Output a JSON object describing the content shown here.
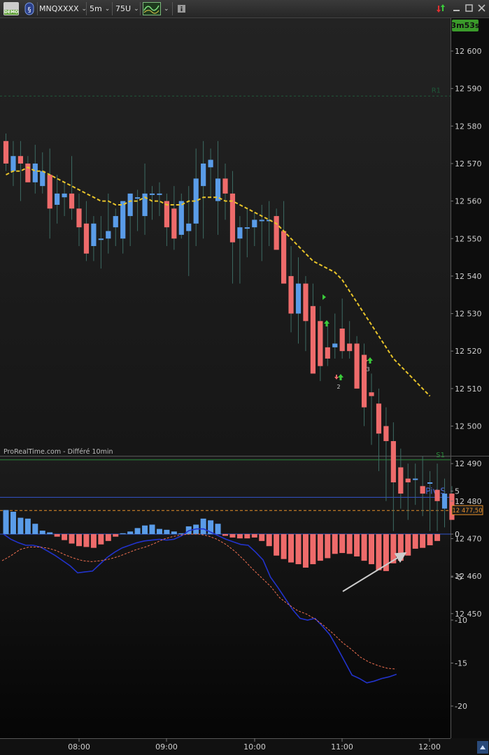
{
  "toolbar": {
    "demo_label": "DEMO",
    "symbol": "MNQXXXX",
    "timeframe": "5m",
    "units": "75U",
    "indicator_icon": "indicator-chart-icon",
    "info_icon": "info-icon"
  },
  "price_panel": {
    "timer": "3m53s",
    "watermark": "ProRealTime.com - Différé 10min",
    "y_ticks": [
      "12 600",
      "12 590",
      "12 580",
      "12 570",
      "12 560",
      "12 550",
      "12 540",
      "12 530",
      "12 520",
      "12 510",
      "12 500",
      "12 490",
      "12 480",
      "12 470",
      "12 460",
      "12 450"
    ],
    "last_price_label": "12 477,50",
    "pivot_label": "Piv S",
    "s1_label": "S1",
    "r1_label": "R1",
    "marker_labels": [
      "2",
      "3"
    ]
  },
  "indicator_panel": {
    "y_ticks": [
      "5",
      "0",
      "-5",
      "-10",
      "-15",
      "-20"
    ]
  },
  "x_axis": {
    "ticks": [
      "08:00",
      "09:00",
      "10:00",
      "11:00",
      "12:00"
    ]
  },
  "colors": {
    "bull": "#5a9ce8",
    "bear": "#ee6b6b",
    "ma": "#e8c42a",
    "signal": "#f07050",
    "macd_line": "#2233cc",
    "pivot": "#3355cc",
    "s1": "#2a8a3a",
    "r1": "#1f5a3a",
    "last": "#e8902a"
  },
  "chart_data": [
    {
      "type": "candlestick",
      "x_start": "07:25",
      "interval_minutes": 5,
      "ylim": [
        12440,
        12606
      ],
      "candles": [
        [
          12576,
          12578,
          12568,
          12570
        ],
        [
          12568,
          12576,
          12564,
          12572
        ],
        [
          12572,
          12576,
          12560,
          12570
        ],
        [
          12570,
          12572,
          12565,
          12565
        ],
        [
          12565,
          12575,
          12562,
          12570
        ],
        [
          12564,
          12573,
          12562,
          12568
        ],
        [
          12567,
          12574,
          12550,
          12558
        ],
        [
          12559,
          12567,
          12554,
          12562
        ],
        [
          12561,
          12565,
          12556,
          12562
        ],
        [
          12562,
          12572,
          12555,
          12558
        ],
        [
          12558,
          12562,
          12548,
          12553
        ],
        [
          12554,
          12560,
          12544,
          12546
        ],
        [
          12548,
          12556,
          12544,
          12554
        ],
        [
          12550,
          12556,
          12542,
          12550
        ],
        [
          12550,
          12562,
          12546,
          12552
        ],
        [
          12553,
          12558,
          12548,
          12556
        ],
        [
          12550,
          12560,
          12546,
          12560
        ],
        [
          12556,
          12562,
          12548,
          12562
        ],
        [
          12561,
          12563,
          12552,
          12561
        ],
        [
          12556,
          12570,
          12551,
          12562
        ],
        [
          12562,
          12564,
          12555,
          12562
        ],
        [
          12562,
          12565,
          12556,
          12562
        ],
        [
          12560,
          12562,
          12548,
          12553
        ],
        [
          12558,
          12564,
          12547,
          12550
        ],
        [
          12551,
          12562,
          12550,
          12560
        ],
        [
          12552,
          12564,
          12540,
          12554
        ],
        [
          12554,
          12574,
          12548,
          12566
        ],
        [
          12564,
          12576,
          12550,
          12570
        ],
        [
          12569,
          12574,
          12561,
          12571
        ],
        [
          12560,
          12576,
          12551,
          12566
        ],
        [
          12566,
          12570,
          12555,
          12562
        ],
        [
          12562,
          12568,
          12538,
          12549
        ],
        [
          12550,
          12556,
          12538,
          12553
        ],
        [
          12553,
          12558,
          12545,
          12553
        ],
        [
          12553,
          12557,
          12548,
          12555
        ],
        [
          12555,
          12559,
          12544,
          12555
        ],
        [
          12555,
          12560,
          12548,
          12555
        ],
        [
          12556,
          12558,
          12548,
          12547
        ],
        [
          12552,
          12560,
          12540,
          12538
        ],
        [
          12540,
          12548,
          12525,
          12530
        ],
        [
          12530,
          12545,
          12522,
          12538
        ],
        [
          12538,
          12540,
          12520,
          12528
        ],
        [
          12532,
          12538,
          12515,
          12514
        ],
        [
          12528,
          12532,
          12512,
          12516
        ],
        [
          12521,
          12528,
          12516,
          12518
        ],
        [
          12521,
          12530,
          12518,
          12522
        ],
        [
          12526,
          12534,
          12518,
          12520
        ],
        [
          12522,
          12528,
          12518,
          12520
        ],
        [
          12522,
          12524,
          12510,
          12510
        ],
        [
          12519,
          12522,
          12500,
          12505
        ],
        [
          12509,
          12514,
          12495,
          12508
        ],
        [
          12506,
          12510,
          12488,
          12498
        ],
        [
          12500,
          12505,
          12480,
          12496
        ],
        [
          12496,
          12501,
          12472,
          12485
        ],
        [
          12489,
          12494,
          12478,
          12482
        ],
        [
          12486,
          12490,
          12475,
          12485
        ],
        [
          12486,
          12490,
          12479,
          12486
        ],
        [
          12484,
          12492,
          12476,
          12482
        ],
        [
          12485,
          12488,
          12472,
          12485
        ],
        [
          12483,
          12490,
          12472,
          12480
        ],
        [
          12478,
          12486,
          12473,
          12482
        ],
        [
          12482,
          12484,
          12475,
          12475
        ]
      ],
      "moving_average": [
        12567,
        12568,
        12568,
        12569,
        12568,
        12568,
        12567,
        12566,
        12565,
        12564,
        12563,
        12562,
        12561,
        12560,
        12560,
        12559,
        12559,
        12560,
        12560,
        12561,
        12560,
        12560,
        12559,
        12559,
        12559,
        12560,
        12560,
        12561,
        12561,
        12561,
        12560,
        12560,
        12559,
        12558,
        12557,
        12556,
        12555,
        12554,
        12552,
        12550,
        12548,
        12546,
        12544,
        12543,
        12542,
        12541,
        12539,
        12536,
        12533,
        12530,
        12527,
        12524,
        12521,
        12518,
        12516,
        12514,
        12512,
        12510,
        12508
      ],
      "levels": {
        "r1": 12588,
        "s1": 12491,
        "pivot_s": 12481,
        "last": 12477.5
      }
    },
    {
      "type": "bar+line",
      "x_start": "07:25",
      "interval_minutes": 5,
      "ylim": [
        -21.5,
        6
      ],
      "histogram": [
        2.8,
        2.6,
        1.9,
        1.8,
        1.2,
        0.4,
        0.2,
        -0.3,
        -0.7,
        -1.1,
        -1.4,
        -1.5,
        -1.6,
        -1.2,
        -0.8,
        -0.3,
        0.1,
        0.3,
        0.7,
        1.0,
        1.1,
        0.6,
        0.5,
        0.3,
        0.1,
        0.9,
        1.1,
        1.8,
        1.6,
        1.2,
        -0.2,
        -0.4,
        -0.5,
        -0.5,
        -0.4,
        -0.8,
        -1.4,
        -2.5,
        -2.9,
        -3.3,
        -3.5,
        -3.9,
        -3.5,
        -3.1,
        -2.8,
        -2.3,
        -2.2,
        -2.3,
        -2.6,
        -3.1,
        -3.5,
        -4.2,
        -4.3,
        -3.4,
        -3.1,
        -2.5,
        -1.7,
        -1.6,
        -1.3,
        -0.8
      ],
      "macd": [
        0.0,
        -0.6,
        -1.0,
        -1.3,
        -1.3,
        -1.5,
        -2.0,
        -2.5,
        -3.1,
        -3.7,
        -4.5,
        -4.4,
        -4.3,
        -3.5,
        -2.7,
        -2.1,
        -1.6,
        -1.3,
        -1.0,
        -0.8,
        -0.7,
        -0.6,
        -0.7,
        -0.6,
        -0.2,
        0.4,
        0.6,
        0.6,
        0.2,
        -0.2,
        -0.6,
        -0.9,
        -1.2,
        -1.3,
        -2.1,
        -3.0,
        -5.0,
        -6.2,
        -7.5,
        -8.8,
        -9.8,
        -10.0,
        -9.8,
        -10.7,
        -11.7,
        -13.2,
        -14.8,
        -16.4,
        -16.8,
        -17.3,
        -17.1,
        -16.8,
        -16.6,
        -16.3
      ],
      "signal": [
        -3.1,
        -2.5,
        -1.8,
        -1.5,
        -1.5,
        -1.6,
        -1.9,
        -2.4,
        -2.8,
        -3.1,
        -3.2,
        -3.1,
        -2.9,
        -2.6,
        -2.2,
        -1.8,
        -1.5,
        -1.1,
        -0.6,
        -0.3,
        -0.1,
        0.0,
        0.0,
        -0.2,
        -0.6,
        -1.2,
        -2.0,
        -3.0,
        -4.1,
        -5.1,
        -6.1,
        -7.4,
        -8.2,
        -8.9,
        -9.3,
        -9.9,
        -10.7,
        -11.6,
        -12.6,
        -13.4,
        -14.3,
        -14.9,
        -15.3,
        -15.6,
        -15.7
      ]
    }
  ]
}
